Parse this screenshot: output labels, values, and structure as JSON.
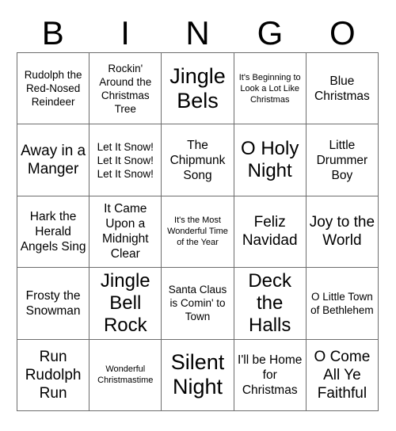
{
  "card": {
    "title": "BINGO",
    "header_letters": [
      "B",
      "I",
      "N",
      "G",
      "O"
    ],
    "grid_size": "5x5",
    "colors": {
      "background": "#ffffff",
      "text": "#000000",
      "grid_line": "#6d6d6d"
    },
    "rows": [
      [
        {
          "text": "Rudolph the Red-Nosed Reindeer",
          "size": "sm"
        },
        {
          "text": "Rockin' Around the Christmas Tree",
          "size": "sm"
        },
        {
          "text": "Jingle Bels",
          "size": "xxl"
        },
        {
          "text": "It's Beginning to Look a Lot Like Christmas",
          "size": "xs"
        },
        {
          "text": "Blue Christmas",
          "size": "md"
        }
      ],
      [
        {
          "text": "Away in a Manger",
          "size": "lg"
        },
        {
          "text": "Let It Snow! Let It Snow! Let It Snow!",
          "size": "sm"
        },
        {
          "text": "The Chipmunk Song",
          "size": "md"
        },
        {
          "text": "O Holy Night",
          "size": "xl"
        },
        {
          "text": "Little Drummer Boy",
          "size": "md"
        }
      ],
      [
        {
          "text": "Hark the Herald Angels Sing",
          "size": "md"
        },
        {
          "text": "It Came Upon a Midnight Clear",
          "size": "md"
        },
        {
          "text": "It's the Most Wonderful Time of the Year",
          "size": "xs"
        },
        {
          "text": "Feliz Navidad",
          "size": "lg"
        },
        {
          "text": "Joy to the World",
          "size": "lg"
        }
      ],
      [
        {
          "text": "Frosty the Snowman",
          "size": "md"
        },
        {
          "text": "Jingle Bell Rock",
          "size": "xl"
        },
        {
          "text": "Santa Claus is Comin' to Town",
          "size": "sm"
        },
        {
          "text": "Deck the Halls",
          "size": "xl"
        },
        {
          "text": "O Little Town of Bethlehem",
          "size": "sm"
        }
      ],
      [
        {
          "text": "Run Rudolph Run",
          "size": "lg"
        },
        {
          "text": "Wonderful Christmastime",
          "size": "xs"
        },
        {
          "text": "Silent Night",
          "size": "xxl"
        },
        {
          "text": "I'll be Home for Christmas",
          "size": "md"
        },
        {
          "text": "O Come All Ye Faithful",
          "size": "lg"
        }
      ]
    ]
  }
}
